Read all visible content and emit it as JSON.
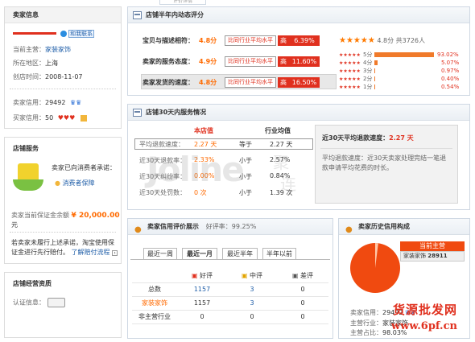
{
  "top_tab": "评价详情",
  "seller_info": {
    "heading": "卖家信息",
    "contact_badge": "和我联系",
    "rows": [
      {
        "label": "当前主营：",
        "value": "家装家饰"
      },
      {
        "label": "所在地区：",
        "value": "上海"
      },
      {
        "label": "创店时间：",
        "value": "2008-11-07"
      }
    ],
    "seller_credit_label": "卖家信用：",
    "seller_credit_value": "29492",
    "buyer_credit_label": "买家信用：",
    "buyer_credit_value": "50"
  },
  "shop_service": {
    "heading": "店铺服务",
    "promise_text": "卖家已向消费者承诺：",
    "protection_link": "消费者保障",
    "deposit_label": "卖家当前保证金余额",
    "deposit_value": "¥ 20,000.00",
    "deposit_unit": "元",
    "claim_text_1": "若卖家未履行上述承诺，淘宝使用保",
    "claim_text_2": "证金进行先行赔付。",
    "claim_link": "了解赔付流程"
  },
  "shop_certs": {
    "heading": "店铺经营资质",
    "cert_label": "认证信息："
  },
  "half_year": {
    "heading": "店铺半年内动态评分",
    "rows": [
      {
        "label": "宝贝与描述相符：",
        "score": "4.8分",
        "compare": "比同行业平均水平",
        "high": "高",
        "pct": "6.39%"
      },
      {
        "label": "卖家的服务态度：",
        "score": "4.9分",
        "compare": "比同行业平均水平",
        "high": "高",
        "pct": "11.60%"
      },
      {
        "label": "卖家发货的速度：",
        "score": "4.8分",
        "compare": "比同行业平均水平",
        "high": "高",
        "pct": "16.50%"
      }
    ],
    "summary_score": "4.8分",
    "summary_count": "共3726人",
    "dist": [
      {
        "label": "5分",
        "pct": "93.02%",
        "frac": 0.9302
      },
      {
        "label": "4分",
        "pct": "5.07%",
        "frac": 0.0507
      },
      {
        "label": "3分",
        "pct": "0.97%",
        "frac": 0.0097
      },
      {
        "label": "2分",
        "pct": "0.40%",
        "frac": 0.004
      },
      {
        "label": "1分",
        "pct": "0.54%",
        "frac": 0.0054
      }
    ]
  },
  "service30": {
    "heading": "店铺30天内服务情况",
    "col_shop": "本店值",
    "col_avg": "行业均值",
    "rows": [
      {
        "label": "平均退款速度：",
        "shop": "2.27 天",
        "cmp": "等于",
        "avg": "2.27 天"
      },
      {
        "label": "近30天退款率：",
        "shop": "2.33%",
        "cmp": "小于",
        "avg": "2.57%"
      },
      {
        "label": "近30天纠纷率：",
        "shop": "0.00%",
        "cmp": "小于",
        "avg": "0.84%"
      },
      {
        "label": "近30天处罚数：",
        "shop": "0 次",
        "cmp": "小于",
        "avg": "1.39 次"
      }
    ],
    "refund_title": "近30天平均退款速度：",
    "refund_value": "2.27 天",
    "refund_desc_1": "平均退款速度：近30天卖家处理完结一笔退",
    "refund_desc_2": "款申请平均花费的时长。"
  },
  "watermark": {
    "left": "J",
    "mid": "oline",
    "right1": "聚",
    "right2": "连"
  },
  "credit_eval": {
    "heading": "卖家信用评价展示",
    "rate_label": "好评率：",
    "rate_value": "99.25%",
    "tabs": [
      "最近一周",
      "最近一月",
      "最近半年",
      "半年以前"
    ],
    "cols": [
      "",
      "好评",
      "中评",
      "差评"
    ],
    "rows": [
      {
        "name": "总数",
        "good": "1157",
        "mid": "3",
        "bad": "0"
      },
      {
        "name": "家装家饰",
        "good": "1157",
        "mid": "3",
        "bad": "0"
      },
      {
        "name": "非主营行业",
        "good": "0",
        "mid": "0",
        "bad": "0"
      }
    ]
  },
  "history": {
    "heading": "卖家历史信用构成",
    "main_label": "当前主营",
    "main_cat": "家装家饰",
    "main_val": "28911",
    "credit_label": "卖家信用：",
    "credit_value": "29492",
    "main_line_label": "主营行业：",
    "main_line_value": "家装家饰",
    "share_label": "主营占比：",
    "share_value": "98.03%",
    "main_share": 0.9803
  },
  "brand_wm": {
    "line1": "货源批发网",
    "line2": "www.6pf.cn"
  },
  "colors": {
    "accent": "#ff6a00",
    "red": "#e0301e",
    "link": "#1f5ea8",
    "pie": "#f04a10"
  }
}
